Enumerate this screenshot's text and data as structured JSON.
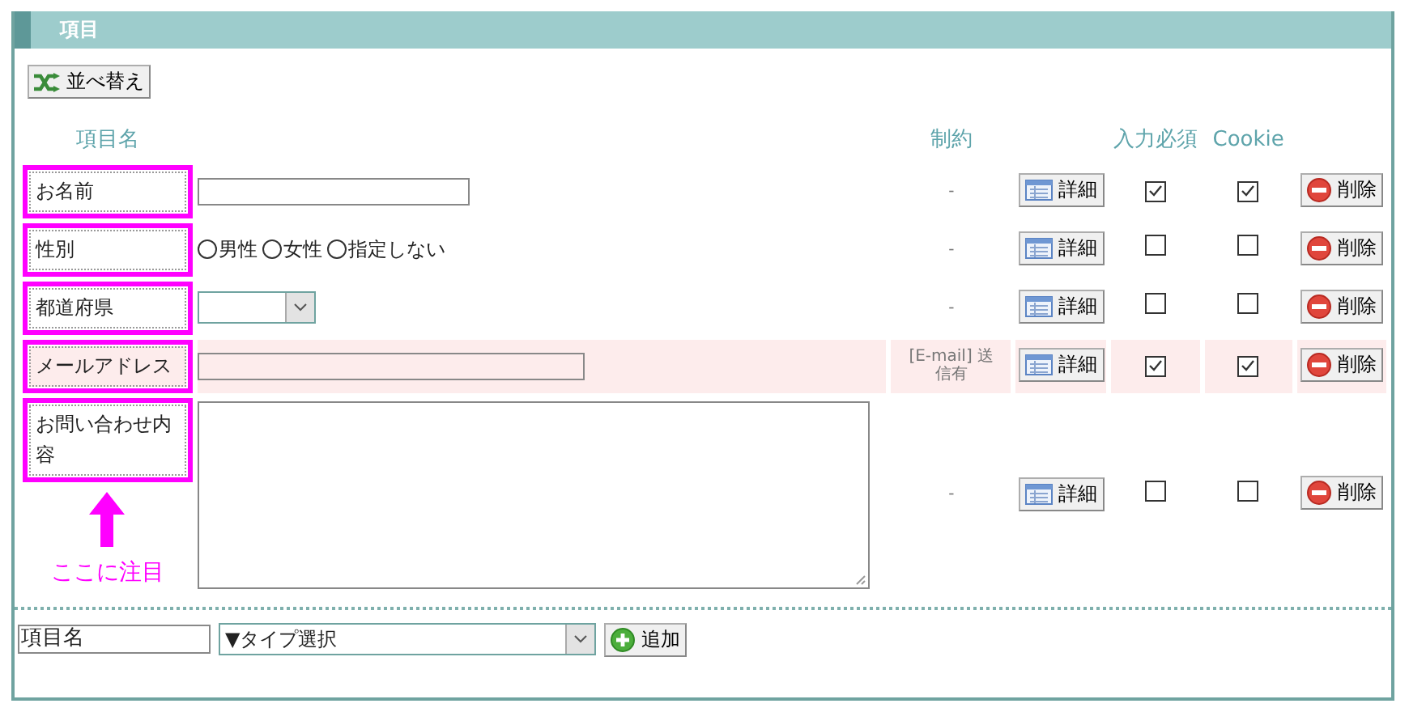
{
  "panel": {
    "title": "項目"
  },
  "sort_button": {
    "label": "並べ替え"
  },
  "columns": {
    "name": "項目名",
    "constraint": "制約",
    "required": "入力必須",
    "cookie": "Cookie"
  },
  "rows": [
    {
      "name": "お名前",
      "kind": "text",
      "constraint": "-",
      "detail": "詳細",
      "required": true,
      "cookie": true,
      "delete": "削除",
      "tinted": false,
      "highlighted": true
    },
    {
      "name": "性別",
      "kind": "radio",
      "options": [
        {
          "label": "男性",
          "selected": false
        },
        {
          "label": "女性",
          "selected": false
        },
        {
          "label": "指定しない",
          "selected": false
        }
      ],
      "constraint": "-",
      "detail": "詳細",
      "required": false,
      "cookie": false,
      "delete": "削除",
      "tinted": false,
      "highlighted": true
    },
    {
      "name": "都道府県",
      "kind": "select",
      "constraint": "-",
      "detail": "詳細",
      "required": false,
      "cookie": false,
      "delete": "削除",
      "tinted": false,
      "highlighted": true
    },
    {
      "name": "メールアドレス",
      "kind": "wide-text",
      "constraint": "[E-mail] 送信有",
      "detail": "詳細",
      "required": true,
      "cookie": true,
      "delete": "削除",
      "tinted": true,
      "highlighted": true
    },
    {
      "name": "お問い合わせ内容",
      "kind": "textarea",
      "constraint": "-",
      "detail": "詳細",
      "required": false,
      "cookie": false,
      "delete": "削除",
      "tinted": false,
      "highlighted": true
    }
  ],
  "annotation": {
    "text": "ここに注目"
  },
  "add_row": {
    "name_value": "項目名",
    "type_value": "▼タイプ選択",
    "button": "追加"
  }
}
